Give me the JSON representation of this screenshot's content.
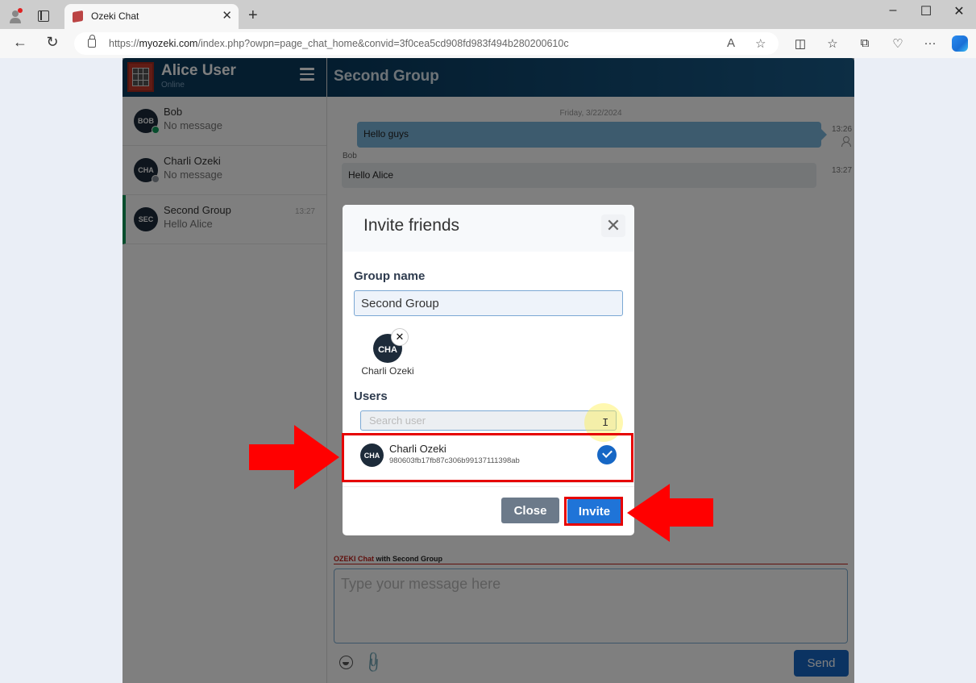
{
  "browser": {
    "tab_title": "Ozeki Chat",
    "url_prefix": "https://",
    "url_domain": "myozeki.com",
    "url_path": "/index.php?owpn=page_chat_home&convid=3f0cea5cd908fd983f494b280200610c",
    "new_tab": "+",
    "window_controls": {
      "minimize": "–",
      "maximize": "☐",
      "close": "✕"
    },
    "nav": {
      "back": "←",
      "refresh": "↻"
    },
    "icons": {
      "read_aloud": "A",
      "favorite": "☆",
      "split": "◫",
      "favorites": "☆",
      "collections": "⧉",
      "health": "♡",
      "more": "···"
    }
  },
  "sidebar": {
    "user_name": "Alice User",
    "user_status": "Online",
    "conversations": [
      {
        "initials": "BOB",
        "name": "Bob",
        "last_message": "No message",
        "time": "",
        "presence": "online",
        "presence_color": "#0e9b5a"
      },
      {
        "initials": "CHA",
        "name": "Charli Ozeki",
        "last_message": "No message",
        "time": "",
        "presence": "offline",
        "presence_color": "#8a939c"
      },
      {
        "initials": "SEC",
        "name": "Second Group",
        "last_message": "Hello Alice",
        "time": "13:27",
        "active": true
      }
    ]
  },
  "chat": {
    "title": "Second Group",
    "date_separator": "Friday, 3/22/2024",
    "messages": [
      {
        "direction": "out",
        "text": "Hello guys",
        "time": "13:26"
      },
      {
        "direction": "in",
        "sender": "Bob",
        "text": "Hello Alice",
        "time": "13:27"
      }
    ],
    "composer": {
      "brand": "OZEKI Chat",
      "label_suffix": " with Second Group",
      "placeholder": "Type your message here",
      "send_label": "Send"
    }
  },
  "modal": {
    "title": "Invite friends",
    "close_glyph": "✕",
    "group_name_label": "Group name",
    "group_name_value": "Second Group",
    "selected_users": [
      {
        "initials": "CHA",
        "name": "Charli Ozeki",
        "remove_glyph": "✕"
      }
    ],
    "users_label": "Users",
    "search_placeholder": "Search user",
    "users": [
      {
        "initials": "CHA",
        "name": "Charli Ozeki",
        "id": "980603fb17fb87c306b99137111398ab",
        "selected": true
      }
    ],
    "close_label": "Close",
    "invite_label": "Invite"
  },
  "colors": {
    "accent": "#1f74d8",
    "header_dark": "#0a3a5c",
    "annotation_red": "#e60000",
    "active_indicator": "#0e9b5a"
  }
}
